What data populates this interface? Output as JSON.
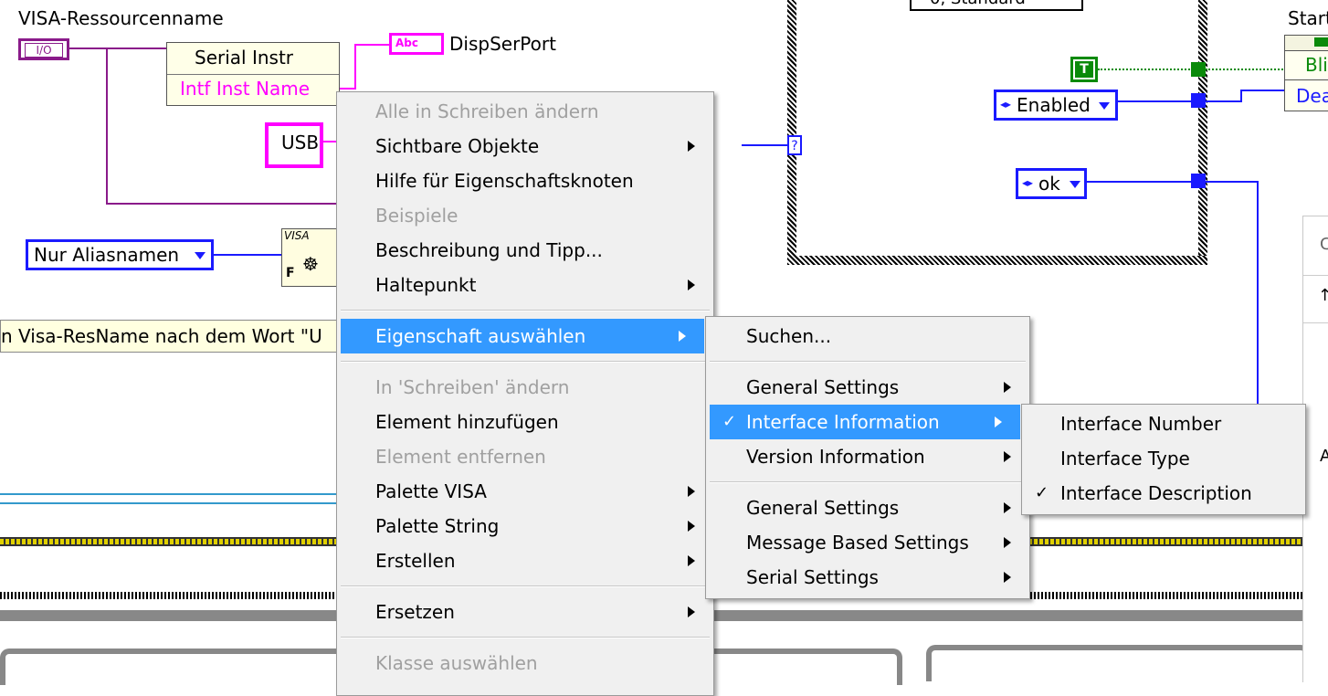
{
  "diagram": {
    "visa_label": "VISA-Ressourcenname",
    "io_terminal": "I/O",
    "property_node": {
      "class_label": "Serial Instr",
      "property": "Intf Inst Name"
    },
    "indicator_label": "DispSerPort",
    "indicator_glyph": "Abc",
    "usb_constant": "USB",
    "alias_ring": "Nur Aliasnamen",
    "find_node_label": "VISA",
    "find_node_f": "F",
    "comment": "n Visa-ResName nach dem Wort \"U",
    "enabled_ring": "Enabled",
    "ok_ring": "ok",
    "true_constant": "T",
    "top_right_label": "Start",
    "bundle_item_1": "Bli",
    "bundle_item_2": "Dea",
    "question_tunnel": "?",
    "partial_ring_top": "0, Standard",
    "right_panel_text_1": "C",
    "right_panel_text_2": "A"
  },
  "menu_main": {
    "items": [
      {
        "label": "Alle in Schreiben ändern",
        "disabled": true,
        "arrow": false
      },
      {
        "label": "Sichtbare Objekte",
        "disabled": false,
        "arrow": true
      },
      {
        "label": "Hilfe für Eigenschaftsknoten",
        "disabled": false,
        "arrow": false
      },
      {
        "label": "Beispiele",
        "disabled": true,
        "arrow": false
      },
      {
        "label": "Beschreibung und Tipp...",
        "disabled": false,
        "arrow": false
      },
      {
        "label": "Haltepunkt",
        "disabled": false,
        "arrow": true
      },
      {
        "label": "Eigenschaft auswählen",
        "disabled": false,
        "arrow": true,
        "highlighted": true
      },
      {
        "label": "In 'Schreiben' ändern",
        "disabled": true,
        "arrow": false
      },
      {
        "label": "Element hinzufügen",
        "disabled": false,
        "arrow": false
      },
      {
        "label": "Element entfernen",
        "disabled": true,
        "arrow": false
      },
      {
        "label": "Palette VISA",
        "disabled": false,
        "arrow": true
      },
      {
        "label": "Palette String",
        "disabled": false,
        "arrow": true
      },
      {
        "label": "Erstellen",
        "disabled": false,
        "arrow": true
      },
      {
        "label": "Ersetzen",
        "disabled": false,
        "arrow": true
      },
      {
        "label": "Klasse auswählen",
        "disabled": true,
        "arrow": false
      }
    ]
  },
  "menu_property": {
    "items": [
      {
        "label": "Suchen..."
      },
      {
        "label": "General Settings",
        "arrow": true
      },
      {
        "label": "Interface Information",
        "arrow": true,
        "checked": true,
        "highlighted": true
      },
      {
        "label": "Version Information",
        "arrow": true
      },
      {
        "label": "General Settings",
        "arrow": true
      },
      {
        "label": "Message Based Settings",
        "arrow": true
      },
      {
        "label": "Serial Settings",
        "arrow": true
      }
    ]
  },
  "menu_interface": {
    "items": [
      {
        "label": "Interface Number"
      },
      {
        "label": "Interface Type"
      },
      {
        "label": "Interface Description",
        "checked": true
      }
    ]
  },
  "glyphs": {
    "check": "✓"
  },
  "colors": {
    "menu_bg": "#f0f0f0",
    "highlight": "#3399ff",
    "wire_pink": "#ff00ff",
    "wire_purple": "#8a1a8a",
    "wire_blue": "#1a1aff",
    "wire_green": "#0a8a0a"
  }
}
